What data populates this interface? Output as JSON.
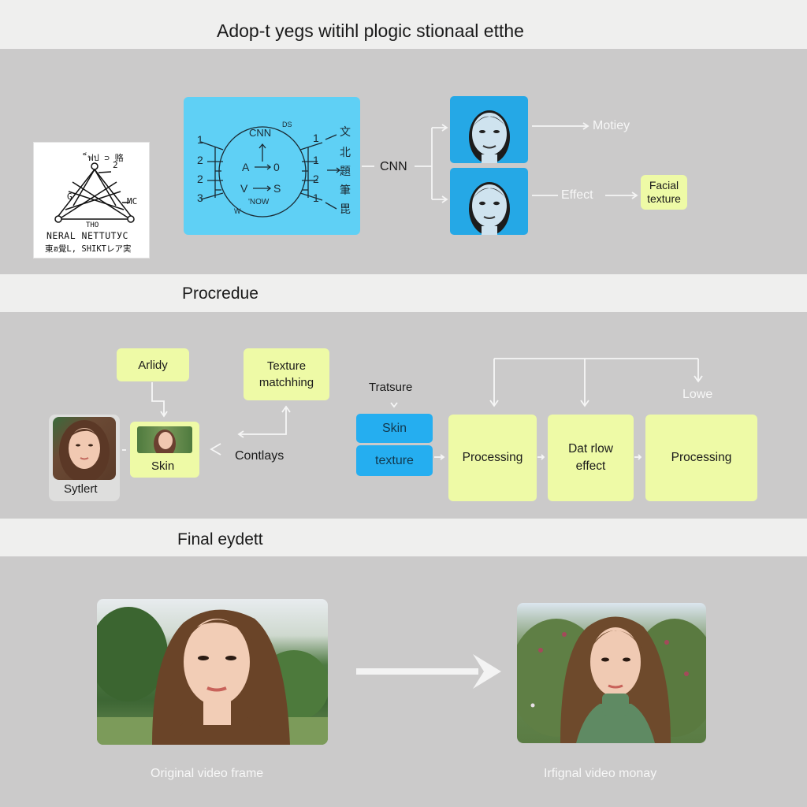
{
  "header": {
    "title": "Adop-t yegs witihl plogic stionaal etthe"
  },
  "section1": {
    "neural_card": {
      "top_label": "็ฟป ⊃ 赂",
      "top_right": "2",
      "left_label": "G",
      "right_label": "MC",
      "bottom_label": "THO",
      "caption_line1": "NERAL NETTUТУC",
      "caption_line2": "東ฮ覺L, SHIKTレア実"
    },
    "cnn_diagram": {
      "top": "CNN",
      "corner": "DS",
      "a": "A",
      "zero": "0",
      "v": "V",
      "s": "S",
      "bottom": "'NOW",
      "corner_bottom": "W",
      "left_numbers": [
        "1",
        "2",
        "2",
        "3"
      ],
      "right_numbers": [
        "1",
        "1",
        "2",
        "1"
      ],
      "right_glyphs": [
        "文",
        "北",
        "題",
        "筆",
        "毘"
      ]
    },
    "cnn_label": "CNN",
    "outputs": [
      {
        "label": "Motiey"
      },
      {
        "label": "Effect",
        "target": "Facial texture"
      }
    ]
  },
  "section2": {
    "title": "Procredue",
    "left_flow": {
      "arlidy": "Arlidy",
      "texture_matching": "Texture matchhing",
      "skin": "Skin",
      "sytlert": "Sytlert",
      "contlays": "Contlays"
    },
    "right_flow": {
      "tratsure": "Tratsure",
      "skin": "Skin",
      "texture": "texture",
      "steps": [
        "Processing",
        "Dat rlow effect",
        "Processing"
      ],
      "lowe": "Lowe"
    }
  },
  "section3": {
    "title": "Final eydett",
    "captions": [
      "Original video frame",
      "Irfignal video monay"
    ]
  },
  "colors": {
    "panel": "#cbcaca",
    "band": "#efefee",
    "cyan": "#5fd0f5",
    "blue": "#25aef0",
    "yellow": "#eefaa6"
  }
}
